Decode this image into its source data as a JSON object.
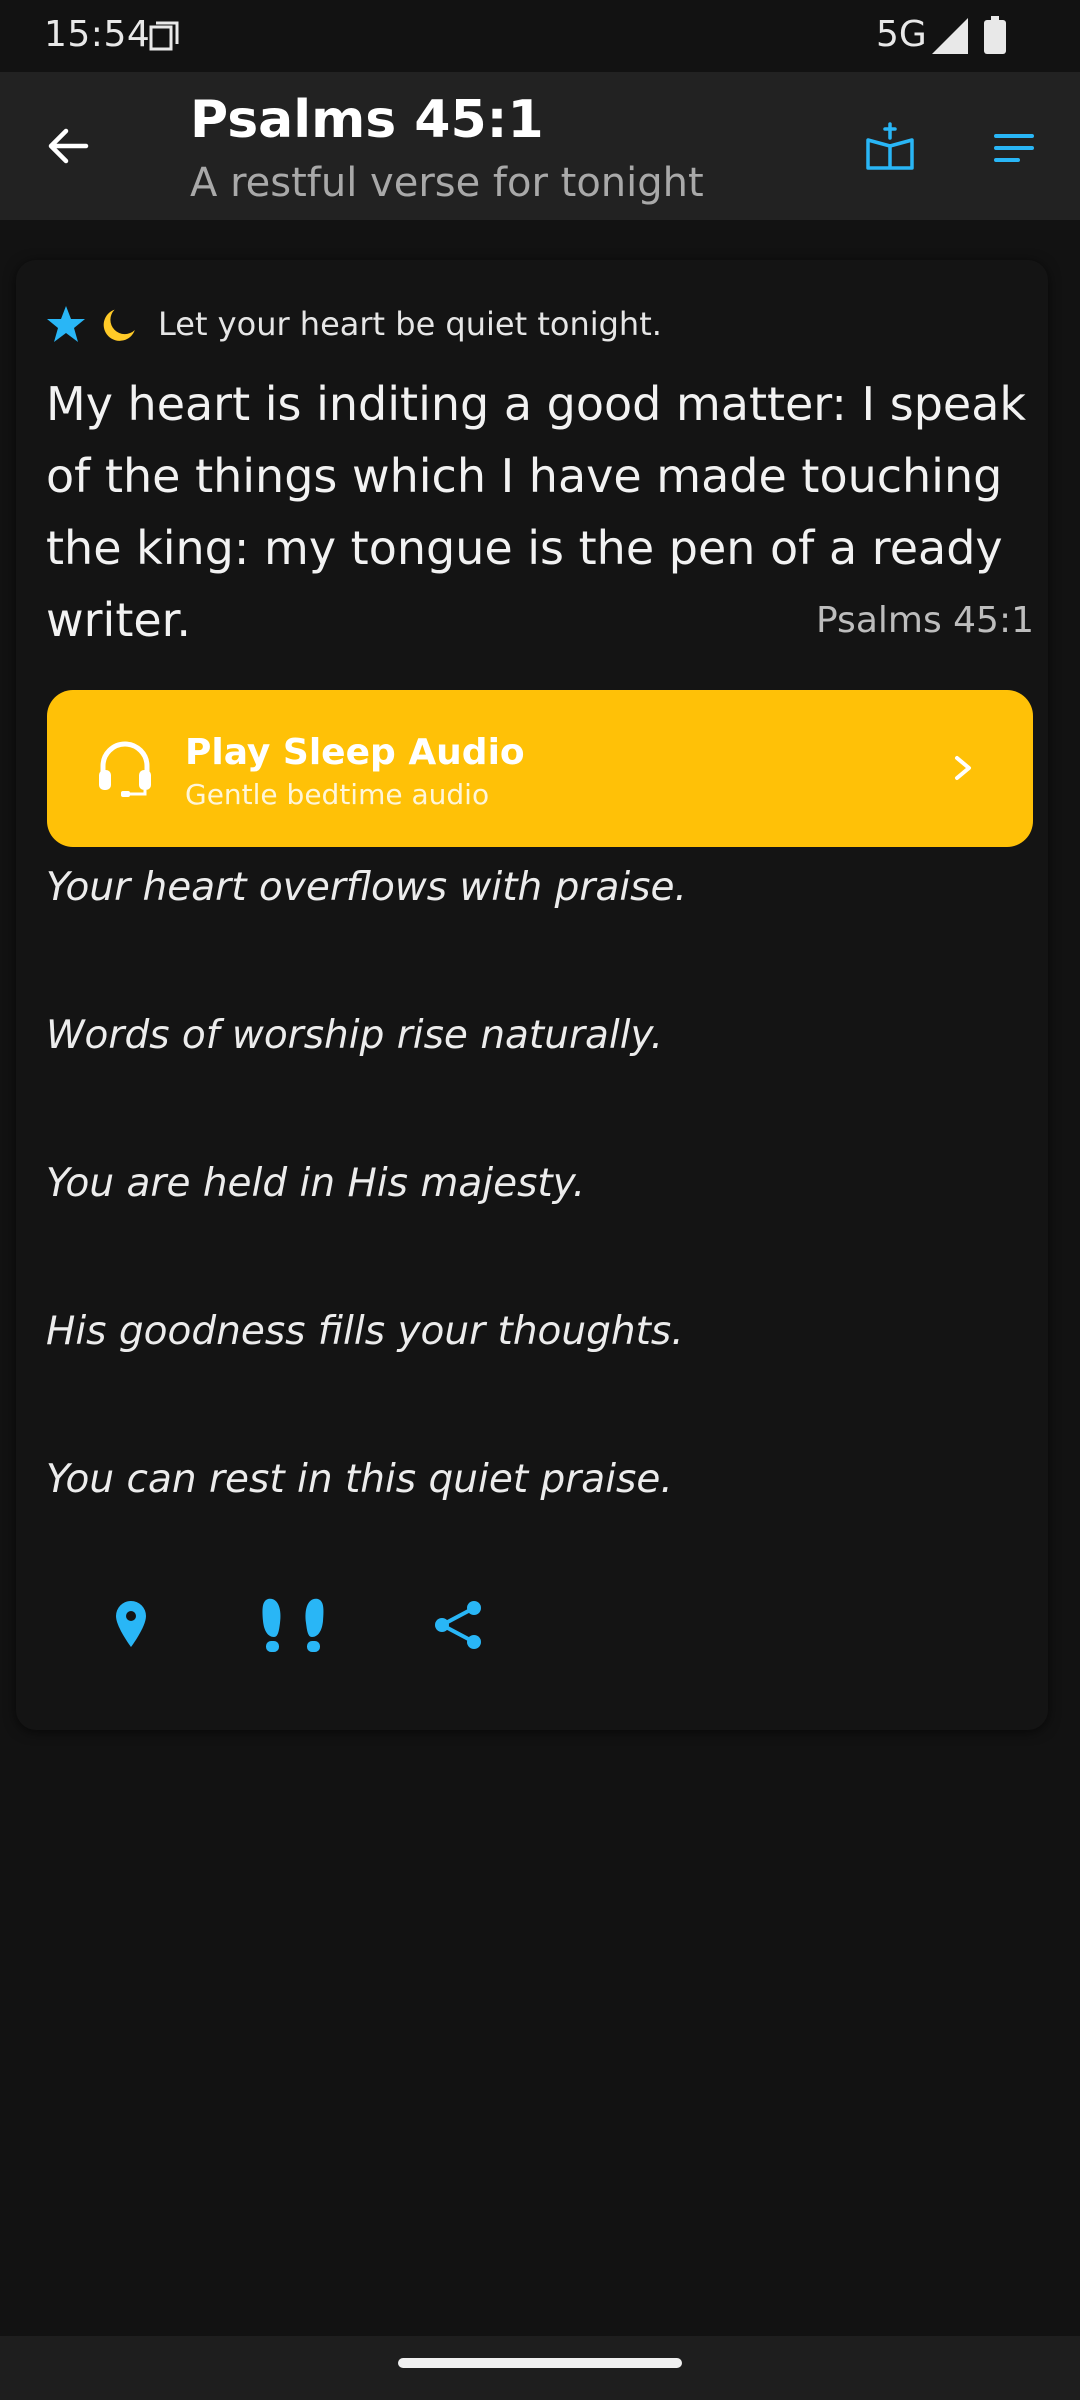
{
  "status_bar": {
    "time": "15:54",
    "network": "5G"
  },
  "app_bar": {
    "title": "Psalms 45:1",
    "subtitle": "A restful verse for tonight"
  },
  "card": {
    "tagline": "Let your heart be quiet tonight.",
    "verse": "My heart is inditing a good matter: I speak of the things which I have made touching the king: my tongue is the pen of a ready writer.",
    "reference": "Psalms 45:1",
    "audio_button": {
      "title": "Play Sleep Audio",
      "subtitle": "Gentle bedtime audio"
    },
    "affirmations": [
      "Your heart overflows with praise.",
      "Words of worship rise naturally.",
      "You are held in His majesty.",
      "His goodness fills your thoughts.",
      "You can rest in this quiet praise."
    ]
  },
  "colors": {
    "accent_blue": "#29b6f6",
    "audio_yellow": "#ffc107",
    "background": "#121212",
    "app_bar": "#222222"
  },
  "icons": [
    "back-arrow-icon",
    "bible-icon",
    "menu-icon",
    "star-icon",
    "moon-icon",
    "headphones-icon",
    "chevron-right-icon",
    "location-pin-icon",
    "footprints-icon",
    "share-icon"
  ]
}
